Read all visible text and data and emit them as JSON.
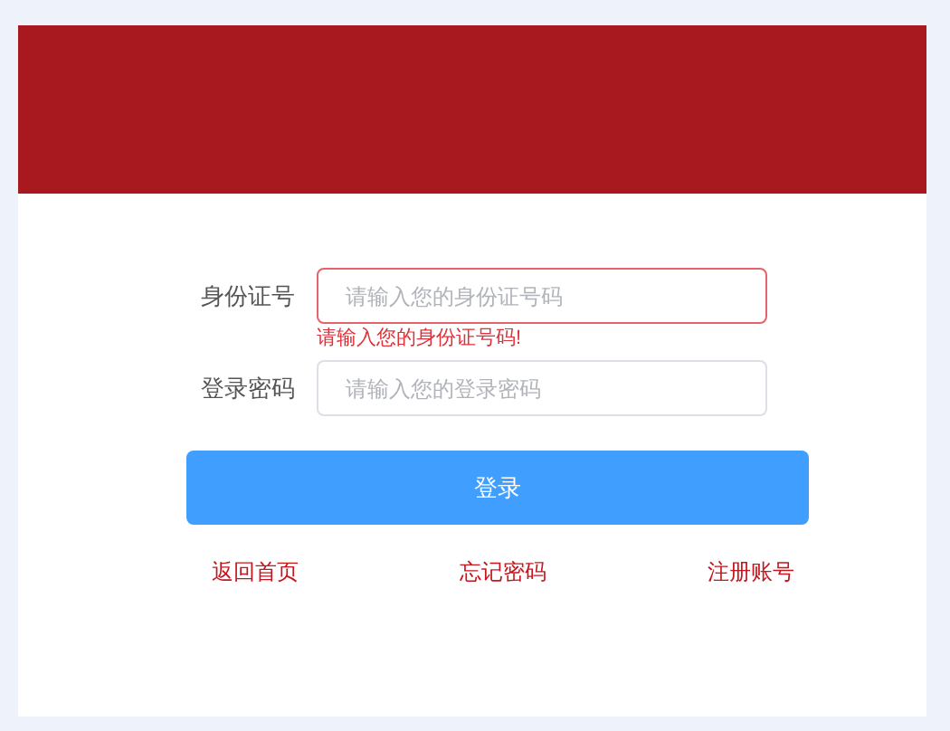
{
  "fields": [
    {
      "label": "身份证号",
      "placeholder": "请输入您的身份证号码",
      "invalid": true,
      "error": "请输入您的身份证号码!"
    },
    {
      "label": "登录密码",
      "placeholder": "请输入您的登录密码",
      "invalid": false
    }
  ],
  "submit": "登录",
  "links": [
    "返回首页",
    "忘记密码",
    "注册账号"
  ]
}
